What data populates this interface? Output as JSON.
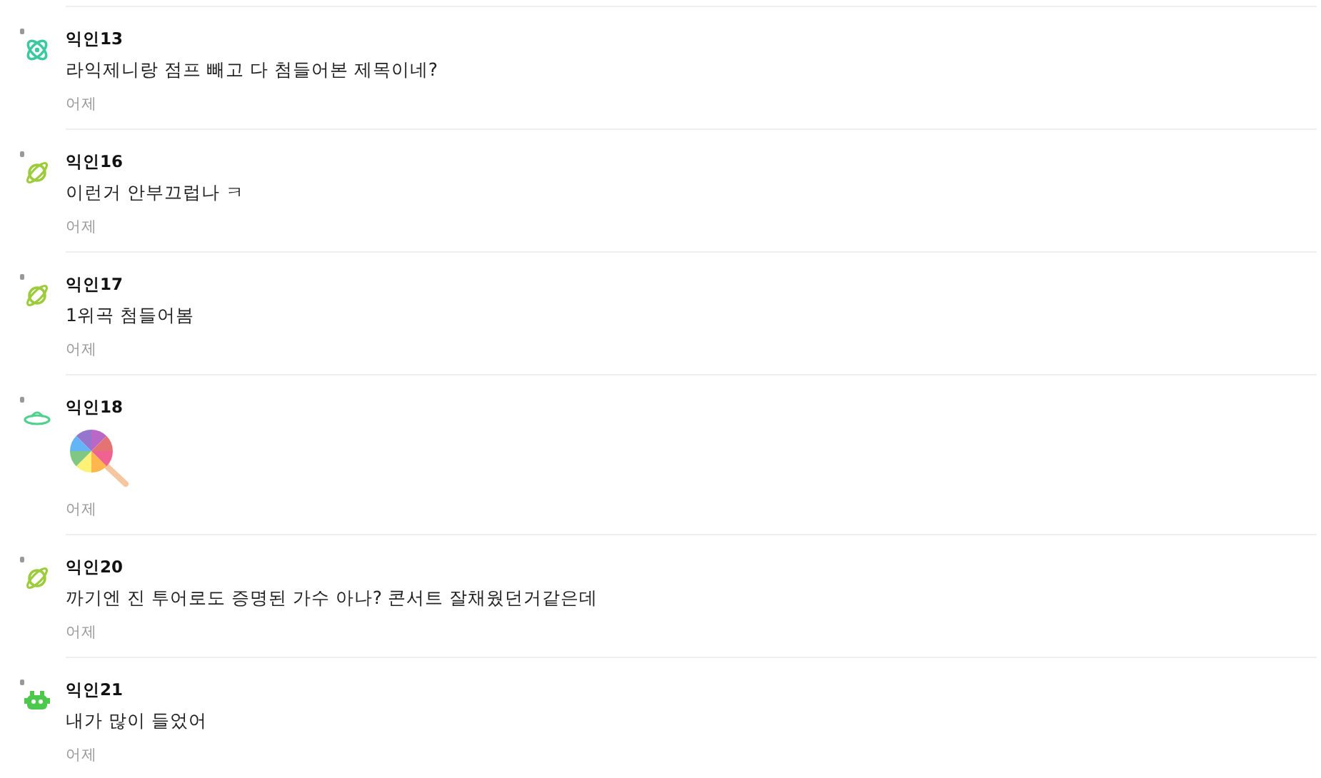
{
  "comments": [
    {
      "author": "익인13",
      "avatar": {
        "kind": "atom",
        "color": "#3cc9a0"
      },
      "body": {
        "kind": "text",
        "text": "라익제니랑 점프 빼고 다 첨들어본 제목이네?"
      },
      "time": "어제"
    },
    {
      "author": "익인16",
      "avatar": {
        "kind": "planet",
        "color": "#9ccc3c"
      },
      "body": {
        "kind": "text",
        "text": "이런거 안부끄럽나 ㅋ"
      },
      "time": "어제"
    },
    {
      "author": "익인17",
      "avatar": {
        "kind": "planet",
        "color": "#9ccc3c"
      },
      "body": {
        "kind": "text",
        "text": "1위곡 첨들어봄"
      },
      "time": "어제"
    },
    {
      "author": "익인18",
      "avatar": {
        "kind": "ufo",
        "color": "#4fd18b"
      },
      "body": {
        "kind": "sticker"
      },
      "time": "어제"
    },
    {
      "author": "익인20",
      "avatar": {
        "kind": "planet",
        "color": "#9ccc3c"
      },
      "body": {
        "kind": "text",
        "text": "까기엔 진 투어로도 증명된 가수 아나? 콘서트 잘채웠던거같은데"
      },
      "time": "어제"
    },
    {
      "author": "익인21",
      "avatar": {
        "kind": "creature",
        "color": "#4cc94c"
      },
      "body": {
        "kind": "text",
        "text": "내가 많이 들었어"
      },
      "time": "어제"
    }
  ]
}
